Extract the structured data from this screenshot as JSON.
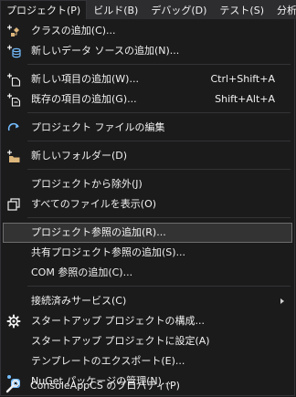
{
  "menubar": {
    "items": [
      {
        "label": "プロジェクト(P)"
      },
      {
        "label": "ビルド(B)"
      },
      {
        "label": "デバッグ(D)"
      },
      {
        "label": "テスト(S)"
      },
      {
        "label": "分析(N)"
      }
    ]
  },
  "menu": {
    "items": [
      {
        "label": "クラスの追加(C)...",
        "icon": "add-class-icon"
      },
      {
        "label": "新しいデータ ソースの追加(N)...",
        "icon": "add-data-source-icon"
      },
      {
        "label": "新しい項目の追加(W)...",
        "shortcut": "Ctrl+Shift+A",
        "icon": "new-item-icon"
      },
      {
        "label": "既存の項目の追加(G)...",
        "shortcut": "Shift+Alt+A",
        "icon": "existing-item-icon"
      },
      {
        "label": "プロジェクト ファイルの編集",
        "icon": "edit-project-icon"
      },
      {
        "label": "新しいフォルダー(D)",
        "icon": "new-folder-icon"
      },
      {
        "label": "プロジェクトから除外(J)"
      },
      {
        "label": "すべてのファイルを表示(O)",
        "icon": "show-all-files-icon"
      },
      {
        "label": "プロジェクト参照の追加(R)..."
      },
      {
        "label": "共有プロジェクト参照の追加(S)..."
      },
      {
        "label": "COM 参照の追加(C)..."
      },
      {
        "label": "接続済みサービス(C)"
      },
      {
        "label": "スタートアップ プロジェクトの構成...",
        "icon": "gear-icon"
      },
      {
        "label": "スタートアップ プロジェクトに設定(A)"
      },
      {
        "label": "テンプレートのエクスポート(E)..."
      },
      {
        "label": "NuGet パッケージの管理(N)...",
        "icon": "nuget-icon"
      },
      {
        "label": "ConsoleAppCS のプロパティ(P)",
        "icon": "wrench-icon"
      }
    ]
  },
  "colors": {
    "background": "#1b1b1c",
    "menubar": "#2d2d30",
    "highlight": "#333334",
    "text": "#f1f1f1",
    "icon_blue": "#75beff",
    "icon_gold": "#dcb67a"
  }
}
